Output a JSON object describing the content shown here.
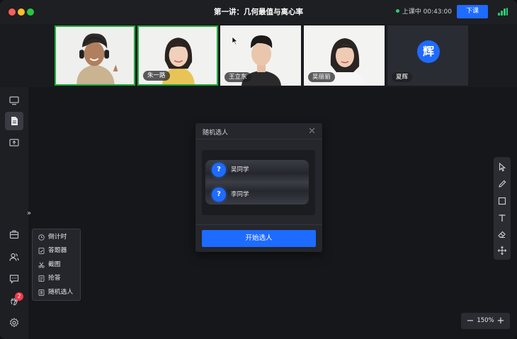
{
  "window": {
    "title": "第一讲：几何最值与离心率"
  },
  "status": {
    "label": "上课中",
    "time": "00:43:00"
  },
  "toolbar": {
    "end_class_label": "下课"
  },
  "participants": [
    {
      "name": "",
      "active": true
    },
    {
      "name": "朱一路",
      "active": true
    },
    {
      "name": "王立东",
      "active": false
    },
    {
      "name": "吴丽丽",
      "active": false
    },
    {
      "name": "夏辉",
      "avatar_char": "辉",
      "active": false
    }
  ],
  "tools_menu": {
    "items": [
      {
        "label": "倒计时",
        "icon": "clock-icon"
      },
      {
        "label": "答题器",
        "icon": "quiz-icon"
      },
      {
        "label": "截图",
        "icon": "scissors-icon"
      },
      {
        "label": "抢答",
        "icon": "buzzer-icon"
      },
      {
        "label": "随机选人",
        "icon": "random-pick-icon"
      }
    ]
  },
  "left_toolbar": {
    "notification_count": "2"
  },
  "dialog": {
    "title": "随机选人",
    "candidates": [
      {
        "mark": "?",
        "name": "吴同学"
      },
      {
        "mark": "?",
        "name": "李同学"
      }
    ],
    "start_label": "开始选人"
  },
  "zoom": {
    "minus": "−",
    "value": "150%",
    "plus": "+"
  },
  "colors": {
    "accent": "#1e6bff",
    "active_border": "#1fae3b",
    "live_dot": "#2ecc71",
    "badge": "#f2394a"
  }
}
